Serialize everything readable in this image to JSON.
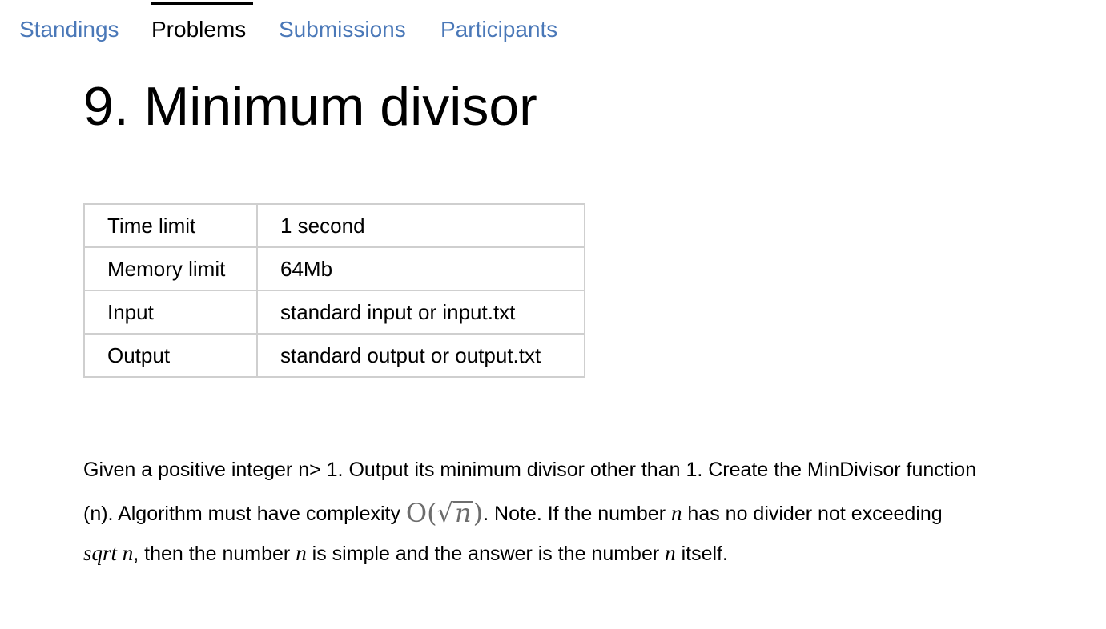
{
  "tabs": [
    {
      "label": "Standings",
      "active": false
    },
    {
      "label": "Problems",
      "active": true
    },
    {
      "label": "Submissions",
      "active": false
    },
    {
      "label": "Participants",
      "active": false
    }
  ],
  "problem": {
    "title": "9. Minimum divisor",
    "limits": [
      {
        "key": "Time limit",
        "value": "1 second"
      },
      {
        "key": "Memory limit",
        "value": "64Mb"
      },
      {
        "key": "Input",
        "value": "standard input or input.txt"
      },
      {
        "key": "Output",
        "value": "standard output or output.txt"
      }
    ],
    "statement": {
      "p1": "Given a positive integer n> 1. Output its minimum divisor other than 1. Create the MinDivisor function",
      "p2a": "(n). Algorithm must have complexity ",
      "formula_o": "O(",
      "formula_sqrt": "√",
      "formula_n": "n",
      "formula_close": ")",
      "p2b": ". Note. If the number ",
      "var_n": "n",
      "p2c": " has no divider not exceeding",
      "sqrt_text": "sqrt n",
      "p3a": ", then the number ",
      "p3b": " is simple and the answer is the number ",
      "p3c": " itself."
    }
  },
  "colors": {
    "link": "#4a78b8",
    "active_tab": "#000000",
    "table_border": "#cfcfcf",
    "formula": "#6d6d6d"
  }
}
